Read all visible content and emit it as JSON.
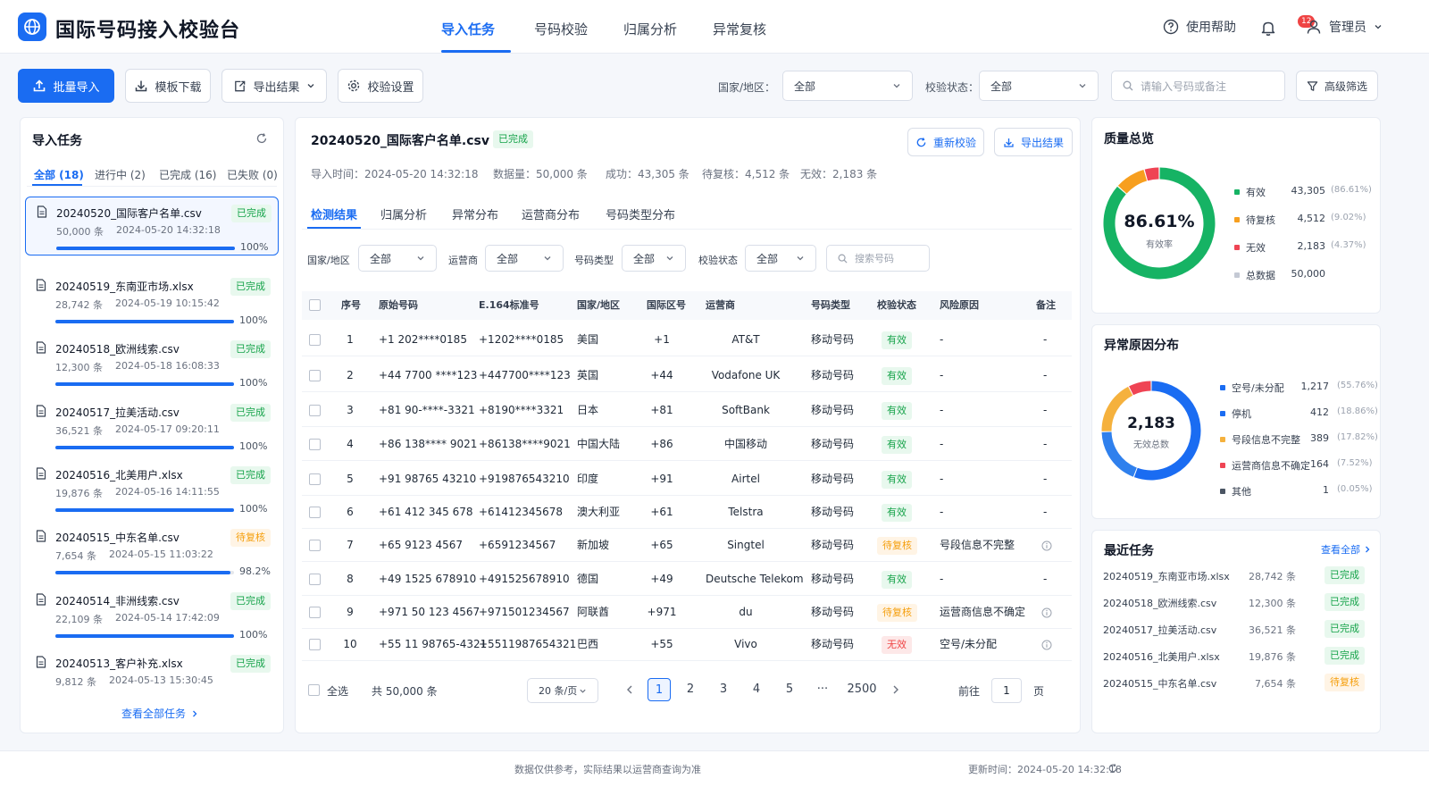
{
  "app": {
    "title": "国际号码接入校验台"
  },
  "nav": {
    "tabs": [
      "导入任务",
      "号码校验",
      "归属分析",
      "异常复核"
    ],
    "active": 0
  },
  "header": {
    "help": "使用帮助",
    "notifications": "12",
    "user": "管理员"
  },
  "toolbar": {
    "batch_import": "批量导入",
    "template_download": "模板下载",
    "export_results": "导出结果",
    "validation_settings": "校验设置",
    "country_label": "国家/地区：",
    "country_value": "全部",
    "status_label": "校验状态：",
    "status_value": "全部",
    "search_placeholder": "请输入号码或备注",
    "advanced_filter": "高级筛选"
  },
  "tasks_panel": {
    "title": "导入任务",
    "tabs": [
      "全部 (18)",
      "进行中 (2)",
      "已完成 (16)",
      "已失败 (0)"
    ],
    "items": [
      {
        "name": "20240520_国际客户名单.csv",
        "count": "50,000 条",
        "time": "2024-05-20 14:32:18",
        "status": "已完成",
        "status_type": "green",
        "progress": 100,
        "pct": "100%"
      },
      {
        "name": "20240519_东南亚市场.xlsx",
        "count": "28,742 条",
        "time": "2024-05-19 10:15:42",
        "status": "已完成",
        "status_type": "green",
        "progress": 100,
        "pct": "100%"
      },
      {
        "name": "20240518_欧洲线索.csv",
        "count": "12,300 条",
        "time": "2024-05-18 16:08:33",
        "status": "已完成",
        "status_type": "green",
        "progress": 100,
        "pct": "100%"
      },
      {
        "name": "20240517_拉美活动.csv",
        "count": "36,521 条",
        "time": "2024-05-17 09:20:11",
        "status": "已完成",
        "status_type": "green",
        "progress": 100,
        "pct": "100%"
      },
      {
        "name": "20240516_北美用户.xlsx",
        "count": "19,876 条",
        "time": "2024-05-16 14:11:55",
        "status": "已完成",
        "status_type": "green",
        "progress": 100,
        "pct": "100%"
      },
      {
        "name": "20240515_中东名单.csv",
        "count": "7,654 条",
        "time": "2024-05-15 11:03:22",
        "status": "待复核",
        "status_type": "orange",
        "progress": 98.2,
        "pct": "98.2%"
      },
      {
        "name": "20240514_非洲线索.csv",
        "count": "22,109 条",
        "time": "2024-05-14 17:42:09",
        "status": "已完成",
        "status_type": "green",
        "progress": 100,
        "pct": "100%"
      },
      {
        "name": "20240513_客户补充.xlsx",
        "count": "9,812 条",
        "time": "2024-05-13 15:30:45",
        "status": "已完成",
        "status_type": "green"
      }
    ],
    "view_all": "查看全部任务"
  },
  "detail": {
    "file": "20240520_国际客户名单.csv",
    "status": "已完成",
    "recheck": "重新校验",
    "export": "导出结果",
    "meta": [
      "导入时间：2024-05-20 14:32:18",
      "数据量：50,000 条",
      "成功：43,305 条",
      "待复核：4,512 条",
      "无效：2,183 条"
    ],
    "subtabs": [
      "检测结果",
      "归属分析",
      "异常分布",
      "运营商分布",
      "号码类型分布"
    ],
    "filters": [
      {
        "label": "国家/地区",
        "value": "全部"
      },
      {
        "label": "运营商",
        "value": "全部"
      },
      {
        "label": "号码类型",
        "value": "全部"
      },
      {
        "label": "校验状态",
        "value": "全部"
      }
    ],
    "search_placeholder": "搜索号码",
    "columns": [
      "序号",
      "原始号码",
      "E.164标准号",
      "国家/地区",
      "国际区号",
      "运营商",
      "号码类型",
      "校验状态",
      "风险原因",
      "备注"
    ],
    "rows": [
      [
        "1",
        "+1 202****0185",
        "+1202****0185",
        "美国",
        "+1",
        "AT&T",
        "移动号码",
        "有效",
        "-",
        "-"
      ],
      [
        "2",
        "+44 7700 ****123",
        "+447700****123",
        "英国",
        "+44",
        "Vodafone UK",
        "移动号码",
        "有效",
        "-",
        "-"
      ],
      [
        "3",
        "+81 90-****-3321",
        "+8190****3321",
        "日本",
        "+81",
        "SoftBank",
        "移动号码",
        "有效",
        "-",
        "-"
      ],
      [
        "4",
        "+86 138**** 9021",
        "+86138****9021",
        "中国大陆",
        "+86",
        "中国移动",
        "移动号码",
        "有效",
        "-",
        "-"
      ],
      [
        "5",
        "+91 98765 43210",
        "+919876543210",
        "印度",
        "+91",
        "Airtel",
        "移动号码",
        "有效",
        "-",
        "-"
      ],
      [
        "6",
        "+61 412 345 678",
        "+61412345678",
        "澳大利亚",
        "+61",
        "Telstra",
        "移动号码",
        "有效",
        "-",
        "-"
      ],
      [
        "7",
        "+65 9123 4567",
        "+6591234567",
        "新加坡",
        "+65",
        "Singtel",
        "移动号码",
        "待复核",
        "号段信息不完整",
        "i"
      ],
      [
        "8",
        "+49 1525 678910",
        "+491525678910",
        "德国",
        "+49",
        "Deutsche Telekom",
        "移动号码",
        "有效",
        "-",
        "-"
      ],
      [
        "9",
        "+971 50 123 4567",
        "+971501234567",
        "阿联酋",
        "+971",
        "du",
        "移动号码",
        "待复核",
        "运营商信息不确定",
        "i"
      ],
      [
        "10",
        "+55 11 98765-4321",
        "+5511987654321",
        "巴西",
        "+55",
        "Vivo",
        "移动号码",
        "无效",
        "空号/未分配",
        "i"
      ]
    ],
    "select_all": "全选",
    "total": "共 50,000 条",
    "page_size": "20 条/页",
    "pages": [
      "1",
      "2",
      "3",
      "4",
      "5",
      "···",
      "2500"
    ],
    "goto_label": "前往",
    "goto_value": "1",
    "page_unit": "页"
  },
  "quality": {
    "title": "质量总览",
    "center_value": "86.61%",
    "center_label": "有效率",
    "items": [
      {
        "label": "有效",
        "value": "43,305",
        "pct": "(86.61%)",
        "color": "#16b364",
        "share": 86.61
      },
      {
        "label": "待复核",
        "value": "4,512",
        "pct": "(9.02%)",
        "color": "#f79f1f",
        "share": 9.02
      },
      {
        "label": "无效",
        "value": "2,183",
        "pct": "(4.37%)",
        "color": "#ef4454",
        "share": 4.37
      },
      {
        "label": "总数据",
        "value": "50,000",
        "pct": "",
        "color": "#c4c9d4"
      }
    ]
  },
  "anomaly": {
    "title": "异常原因分布",
    "center_value": "2,183",
    "center_label": "无效总数",
    "items": [
      {
        "label": "空号/未分配",
        "value": "1,217",
        "pct": "(55.76%)",
        "color": "#1a6cf2",
        "share": 55.76
      },
      {
        "label": "停机",
        "value": "412",
        "pct": "(18.86%)",
        "color": "#1a6cf2",
        "share": 18.86
      },
      {
        "label": "号段信息不完整",
        "value": "389",
        "pct": "(17.82%)",
        "color": "#f5b13d",
        "share": 17.82
      },
      {
        "label": "运营商信息不确定",
        "value": "164",
        "pct": "(7.52%)",
        "color": "#ef4454",
        "share": 7.52
      },
      {
        "label": "其他",
        "value": "1",
        "pct": "(0.05%)",
        "color": "#4b5563",
        "share": 0.05
      }
    ]
  },
  "recent": {
    "title": "最近任务",
    "view_all": "查看全部",
    "items": [
      {
        "name": "20240519_东南亚市场.xlsx",
        "count": "28,742 条",
        "status": "已完成",
        "status_type": "green"
      },
      {
        "name": "20240518_欧洲线索.csv",
        "count": "12,300 条",
        "status": "已完成",
        "status_type": "green"
      },
      {
        "name": "20240517_拉美活动.csv",
        "count": "36,521 条",
        "status": "已完成",
        "status_type": "green"
      },
      {
        "name": "20240516_北美用户.xlsx",
        "count": "19,876 条",
        "status": "已完成",
        "status_type": "green"
      },
      {
        "name": "20240515_中东名单.csv",
        "count": "7,654 条",
        "status": "待复核",
        "status_type": "orange"
      }
    ]
  },
  "footer": {
    "note": "数据仅供参考，实际结果以运营商查询为准",
    "updated": "更新时间：2024-05-20 14:32:18"
  }
}
